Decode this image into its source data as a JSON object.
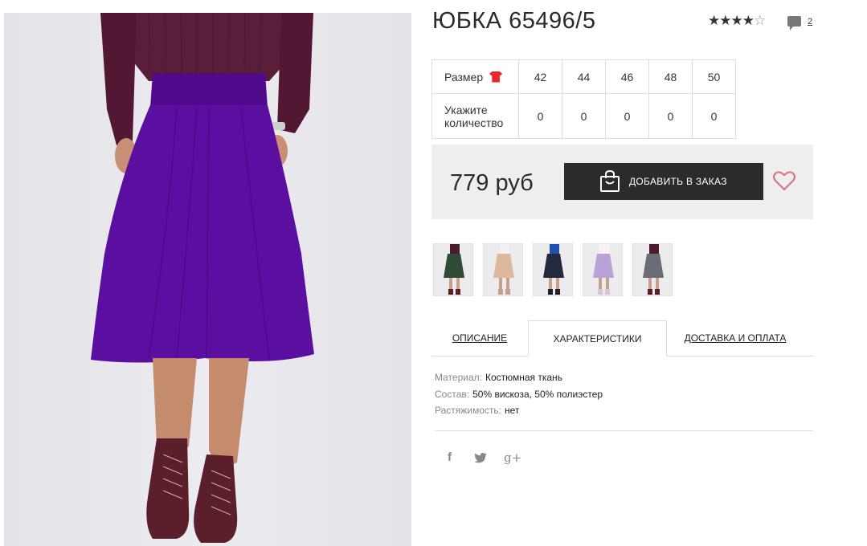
{
  "product": {
    "title": "ЮБКА 65496/5",
    "rating_stars": "★★★★",
    "rating_empty": "☆",
    "rating_value": 4,
    "comments_count": "2"
  },
  "size_table": {
    "size_label": "Размер",
    "qty_label": "Укажите количество",
    "sizes": [
      "42",
      "44",
      "46",
      "48",
      "50"
    ],
    "quantities": [
      "0",
      "0",
      "0",
      "0",
      "0"
    ]
  },
  "purchase": {
    "price": "779 руб",
    "add_button_label": "ДОБАВИТЬ В ЗАКАЗ"
  },
  "thumbnails": [
    {
      "skirt_color": "#2f4a35",
      "top_color": "#4a1c2c"
    },
    {
      "skirt_color": "#dcb99b",
      "top_color": "#f1f1f1"
    },
    {
      "skirt_color": "#242a3d",
      "top_color": "#1f4fb0"
    },
    {
      "skirt_color": "#b9a3d6",
      "top_color": "#f4f4f4"
    },
    {
      "skirt_color": "#6b6d74",
      "top_color": "#4a1c2c"
    }
  ],
  "tabs": {
    "description": "ОПИСАНИЕ",
    "characteristics": "ХАРАКТЕРИСТИКИ",
    "delivery": "ДОСТАВКА И ОПЛАТА"
  },
  "specs": {
    "material_label": "Материал:",
    "material_value": "Костюмная ткань",
    "composition_label": "Состав:",
    "composition_value": "50% вискоза, 50% полиэстер",
    "stretch_label": "Растяжимость:",
    "stretch_value": "нет"
  },
  "social": {
    "facebook": "f",
    "twitter": "twitter-icon",
    "gplus": "g+"
  },
  "colors": {
    "skirt": "#5b0fa0",
    "top": "#5a1d3a",
    "boots": "#5a1f2a",
    "dark_button": "#2b2b2b",
    "heart": "#e06b7d",
    "size_icon": "#e8262b"
  }
}
